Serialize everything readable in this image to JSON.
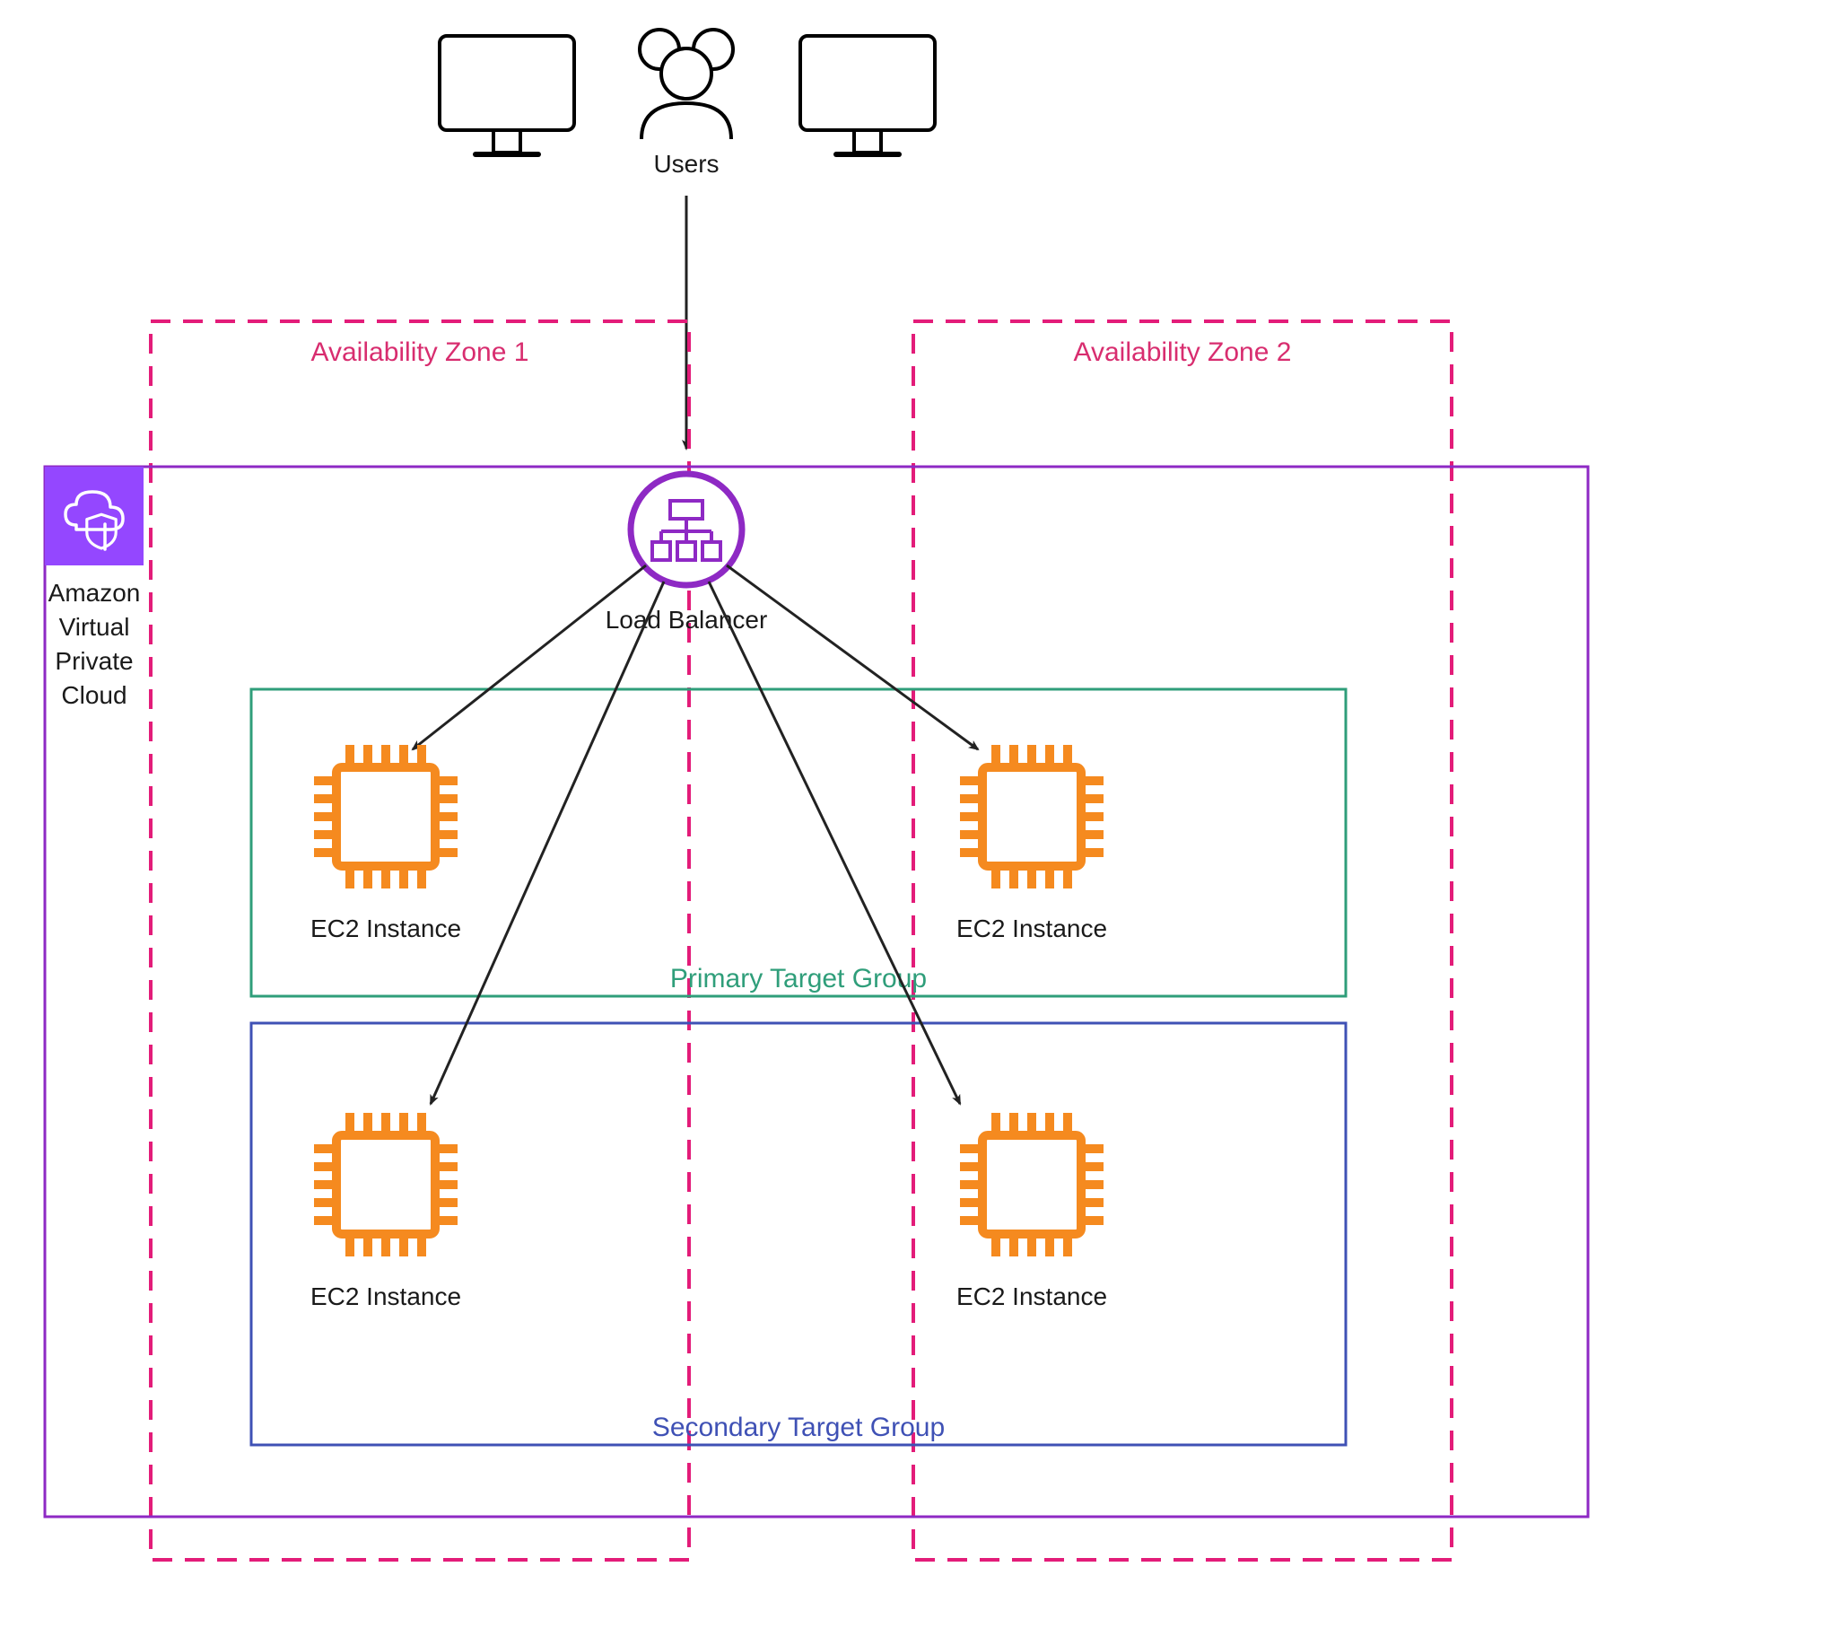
{
  "users_label": "Users",
  "load_balancer_label": "Load Balancer",
  "vpc_label_lines": [
    "Amazon",
    "Virtual",
    "Private",
    "Cloud"
  ],
  "az1_label": "Availability Zone 1",
  "az2_label": "Availability Zone 2",
  "primary_tg_label": "Primary Target Group",
  "secondary_tg_label": "Secondary Target Group",
  "ec2_label": "EC2 Instance",
  "colors": {
    "vpc_border": "#8e29c4",
    "vpc_badge_bg": "#9447ff",
    "az_border": "#e31c79",
    "primary_tg": "#2f9e7a",
    "secondary_tg": "#3f51b5",
    "ec2": "#f58a1f",
    "lb": "#8e29c4",
    "arrow": "#222222"
  }
}
